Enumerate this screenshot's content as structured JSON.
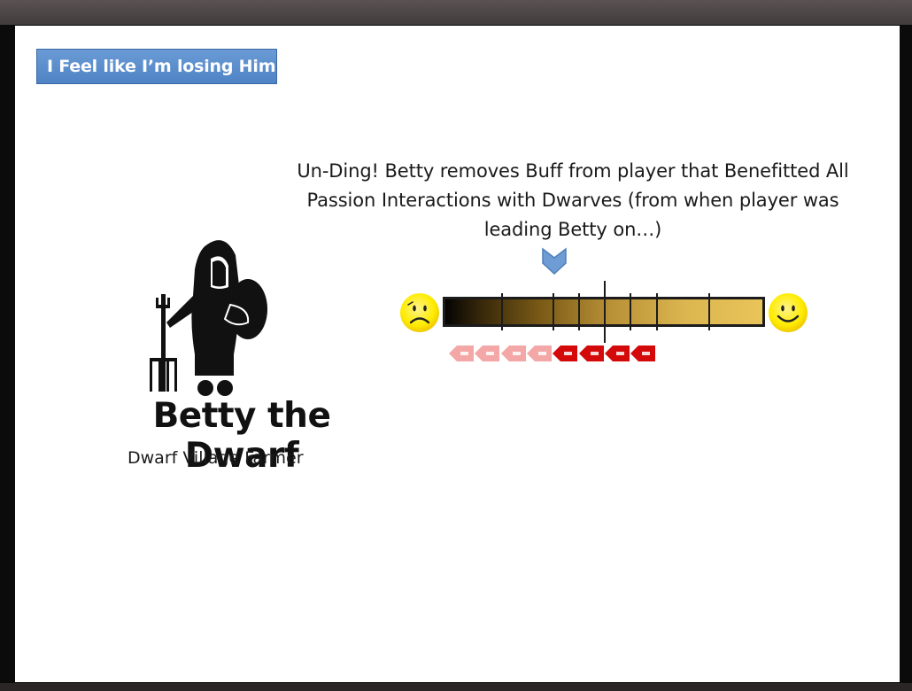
{
  "slide": {
    "title": "I Feel like I’m losing Him",
    "caption_lines": [
      "Un-Ding! Betty removes Buff from player that Benefitted All",
      "Passion Interactions with Dwarves (from when player was",
      "leading Betty on…)"
    ],
    "character": {
      "name": "Betty the Dwarf",
      "role": "Dwarf Village Farmer"
    },
    "meter": {
      "left_face": "sad-face-icon",
      "right_face": "happy-face-icon",
      "marker_icon": "down-arrow-icon",
      "colors": {
        "bar_dark": "#050403",
        "bar_light": "#e8c45a",
        "arrow_faded": "#f4a7a7",
        "arrow_active": "#d40a0a",
        "marker": "#6f9cd4",
        "face": "#ffec00"
      },
      "arrows": [
        {
          "state": "faded"
        },
        {
          "state": "faded"
        },
        {
          "state": "faded"
        },
        {
          "state": "faded"
        },
        {
          "state": "active"
        },
        {
          "state": "active"
        },
        {
          "state": "active"
        },
        {
          "state": "active"
        }
      ]
    }
  }
}
